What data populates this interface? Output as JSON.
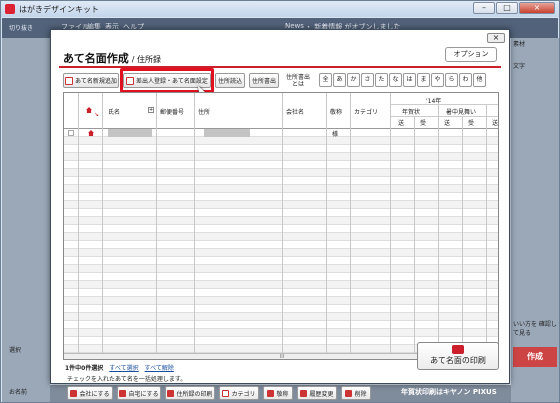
{
  "app": {
    "title": "はがきデザインキット"
  },
  "background": {
    "menu": [
      "ファイル",
      "編集",
      "表示",
      "ヘルプ",
      "News",
      "・ 新着情報 がオブンしました"
    ],
    "left_items": [
      "切り抜き",
      "選択",
      "お名前"
    ],
    "right_items": [
      "素材",
      "文字",
      "いい方を 確認して見る"
    ],
    "sakusei": "作成",
    "ad": "年賀状印刷はキヤノン PIXUS"
  },
  "dialog": {
    "title": "あて名面作成",
    "subtitle": "/ 住所録",
    "options_label": "オプション",
    "close_label": "×",
    "toolbar": {
      "new_address": "あて名新規追加",
      "import_settings": "差出人登録・あて名面設定",
      "import_address": "住所読込",
      "export_address": "住所書出",
      "export_search": "住所書出 とは"
    },
    "kana_filters": [
      "全",
      "あ",
      "か",
      "さ",
      "た",
      "な",
      "は",
      "ま",
      "や",
      "ら",
      "わ",
      "他"
    ],
    "table": {
      "col_name": "氏名",
      "col_zip": "郵便番号",
      "col_address": "住所",
      "col_company": "会社名",
      "col_honorific": "敬称",
      "col_category": "カテゴリ",
      "year_header": "'14年",
      "group_nenga": "年賀状",
      "group_shochu": "暑中見舞い",
      "sub_send": "送",
      "sub_recv": "受",
      "row1_honorific": "様"
    },
    "footer": {
      "selection_count": "1件中0件選択",
      "select_all": "すべて選択",
      "deselect_all": "すべて解除",
      "bulk_note": "チェックを入れたあて名を一括処理します。",
      "buttons": [
        "会社にする",
        "自宅にする",
        "住所録の印刷",
        "カテゴリ",
        "敬称",
        "履歴変更",
        "削除"
      ],
      "print_label": "あて名面の印刷"
    }
  }
}
